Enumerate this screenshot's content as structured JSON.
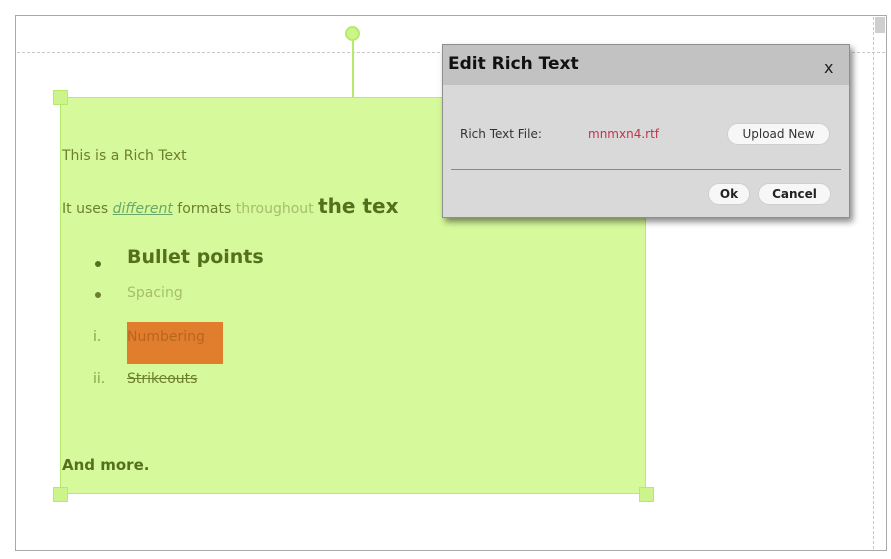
{
  "rich_text": {
    "line1": "This is a Rich Text",
    "line2": {
      "prefix": "It uses ",
      "different": "different",
      "formats": " formats ",
      "throughout": "throughout ",
      "the_text": "the tex"
    },
    "bullets": [
      "Bullet points",
      "Spacing"
    ],
    "numbered": [
      {
        "marker": "i.",
        "text": "Numbering"
      },
      {
        "marker": "ii.",
        "text": "Strikeouts"
      }
    ],
    "closing": "And more."
  },
  "dialog": {
    "title": "Edit Rich Text",
    "close_label": "x",
    "file_label": "Rich Text File:",
    "file_name": "mnmxn4.rtf",
    "upload_label": "Upload New",
    "ok_label": "Ok",
    "cancel_label": "Cancel"
  },
  "colors": {
    "box_fill": "#d6f99b",
    "box_border": "#b6ea6a",
    "highlight": "#e07e2e",
    "dialog_bg": "#d9d9d9",
    "file_name": "#c2334b"
  }
}
